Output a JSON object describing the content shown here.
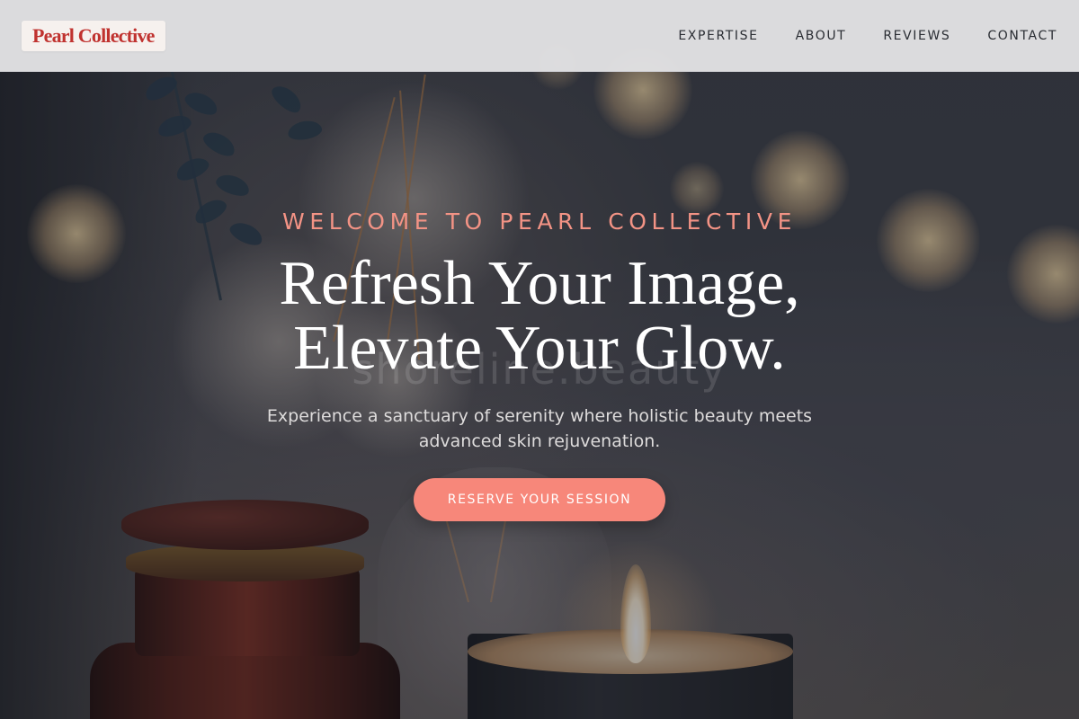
{
  "header": {
    "logo_text": "Pearl Collective",
    "nav": [
      {
        "label": "EXPERTISE"
      },
      {
        "label": "ABOUT"
      },
      {
        "label": "REVIEWS"
      },
      {
        "label": "CONTACT"
      }
    ]
  },
  "hero": {
    "eyebrow": "WELCOME TO PEARL COLLECTIVE",
    "headline_line1": "Refresh Your Image,",
    "headline_line2": "Elevate Your Glow.",
    "subtext": "Experience a sanctuary of serenity where holistic beauty meets advanced skin rejuvenation.",
    "cta_label": "RESERVE YOUR SESSION",
    "background_watermark": "shoreline.beauty"
  },
  "colors": {
    "accent": "#f7877a",
    "eyebrow": "#f39385",
    "logo": "#c0322f",
    "header_bg": "#e2e2e4"
  }
}
